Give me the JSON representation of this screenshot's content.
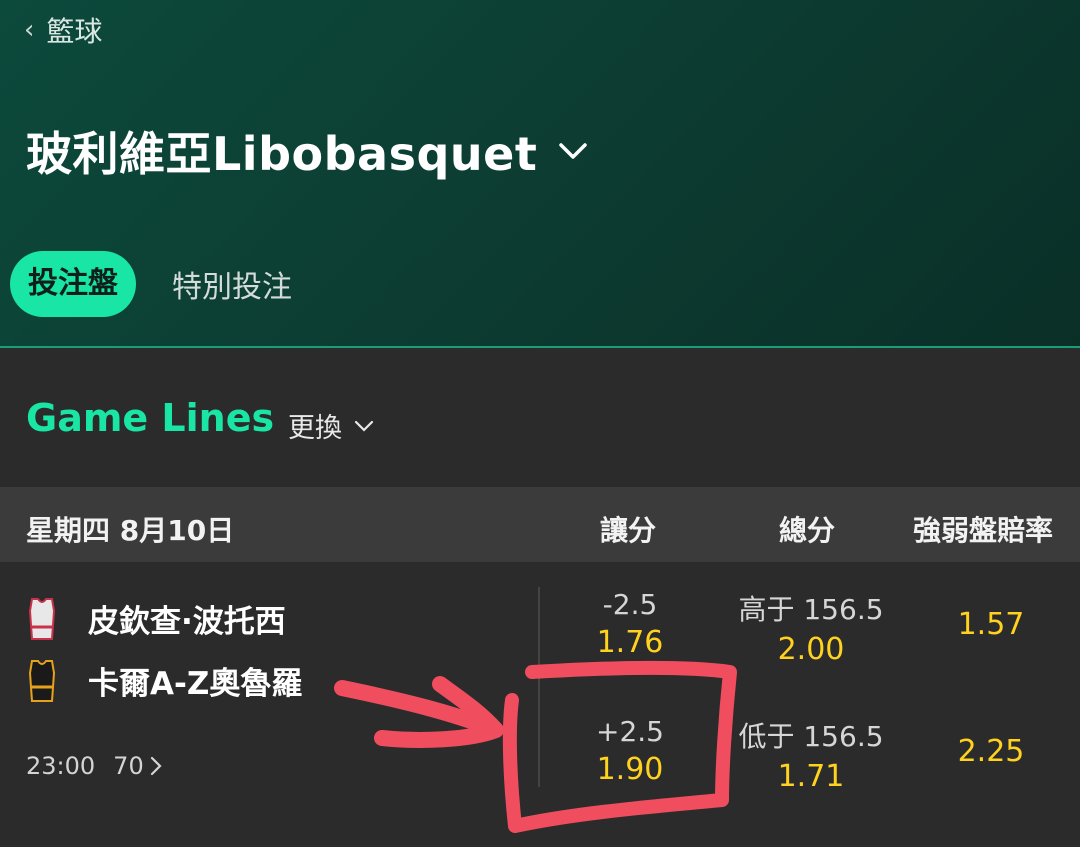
{
  "header": {
    "back_label": "籃球",
    "league_title": "玻利維亞Libobasquet",
    "tabs": [
      "投注盤",
      "特別投注"
    ]
  },
  "section": {
    "title": "Game Lines",
    "switch_label": "更換"
  },
  "columns": {
    "date": "星期四 8月10日",
    "spread": "讓分",
    "total": "總分",
    "moneyline": "強弱盤賠率"
  },
  "match": {
    "home": {
      "name": "皮欽查·波托西",
      "jersey_color": "#e8e8e8",
      "jersey_trim": "#c8324a"
    },
    "away": {
      "name": "卡爾A-Z奧魯羅",
      "jersey_color": "#1a1a1a",
      "jersey_trim": "#e8a21a"
    },
    "time": "23:00",
    "markets_count": "70",
    "spread": [
      {
        "line": "-2.5",
        "price": "1.76"
      },
      {
        "line": "+2.5",
        "price": "1.90"
      }
    ],
    "total": [
      {
        "line": "高于 156.5",
        "price": "2.00"
      },
      {
        "line": "低于 156.5",
        "price": "1.71"
      }
    ],
    "moneyline": [
      "1.57",
      "2.25"
    ]
  },
  "colors": {
    "accent": "#19e6a5",
    "odds": "#ffd21f",
    "annotation": "#f04e5e"
  }
}
